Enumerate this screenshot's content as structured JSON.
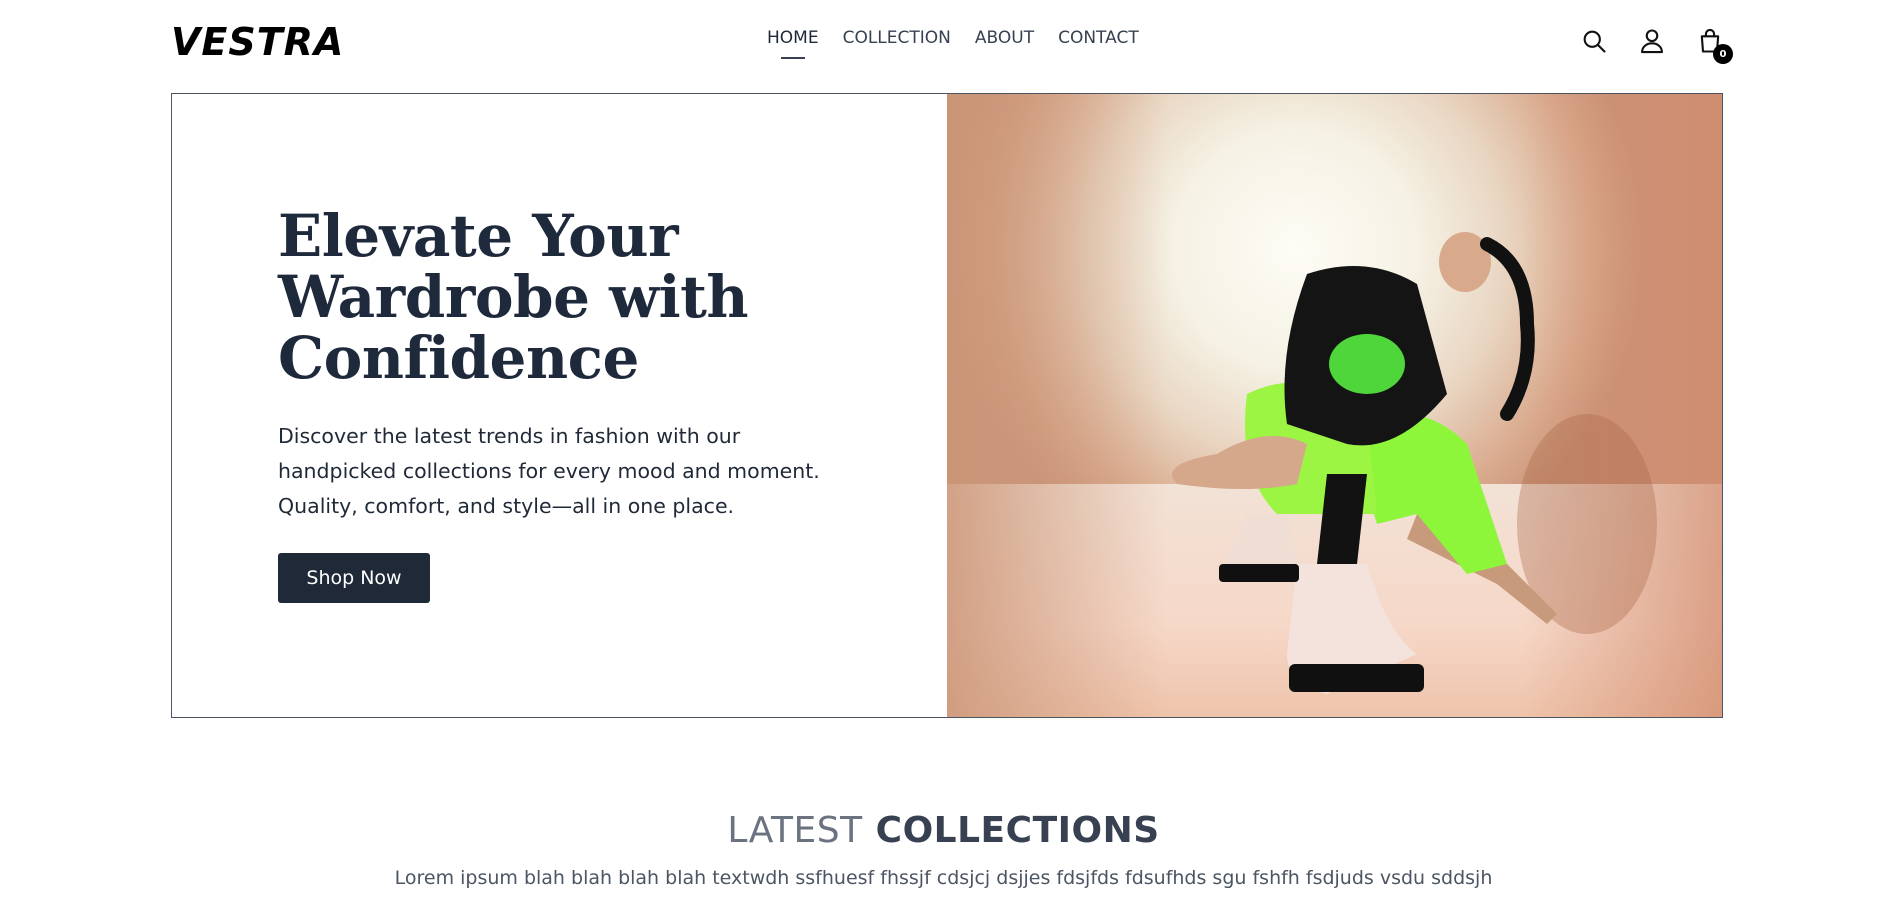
{
  "header": {
    "logo": "VESTRA",
    "nav": [
      {
        "label": "HOME",
        "active": true
      },
      {
        "label": "COLLECTION",
        "active": false
      },
      {
        "label": "ABOUT",
        "active": false
      },
      {
        "label": "CONTACT",
        "active": false
      }
    ],
    "icons": [
      "search-icon",
      "user-icon",
      "cart-icon"
    ],
    "cart_count": "0"
  },
  "hero": {
    "title_lines": [
      "Elevate Your",
      "Wardrobe with",
      "Confidence"
    ],
    "description_lines": [
      "Discover the latest trends in fashion with our",
      "handpicked collections for every mood and moment.",
      "Quality, comfort, and style—all in one place."
    ],
    "cta_label": "Shop Now"
  },
  "collections": {
    "title_light": "LATEST",
    "title_bold": "COLLECTIONS",
    "subtitle": "Lorem ipsum blah blah blah blah textwdh ssfhuesf fhssjf cdsjcj dsjjes fdsjfds fdsufhds sgu fshfh fsdjuds vsdu sddsjh"
  },
  "colors": {
    "primary": "#1f2937",
    "text_muted": "#6b7280",
    "accent_green": "#7cf02c"
  }
}
